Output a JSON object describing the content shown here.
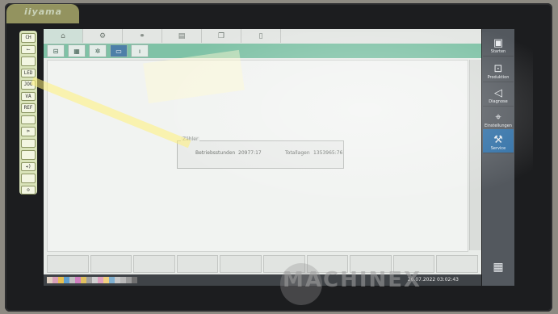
{
  "monitor": {
    "brand": "iiyama"
  },
  "keypad": {
    "keys": [
      "CH",
      "⟵",
      "",
      "LED",
      "JOG",
      "VA",
      "REF",
      "",
      "⊳",
      "",
      "",
      "◂)",
      "",
      "⊙"
    ]
  },
  "top_tabs": [
    "",
    "",
    "",
    "",
    "",
    ""
  ],
  "info_box": {
    "legend": "Zähler",
    "operating_hours_label": "Betriebsstunden",
    "operating_hours_value": "20977:17",
    "total_label": "Totallagen",
    "total_value": "1353965:76"
  },
  "right_panel": {
    "items": [
      {
        "label": "Starten",
        "icon": "home-icon"
      },
      {
        "label": "Produktion",
        "icon": "production-icon"
      },
      {
        "label": "Diagnose",
        "icon": "diagnosis-icon"
      },
      {
        "label": "Einstellungen",
        "icon": "settings-icon"
      },
      {
        "label": "Service",
        "icon": "wrench-icon",
        "active": true
      }
    ]
  },
  "status": {
    "datetime": "26.07.2022  03:02:43"
  },
  "watermark": {
    "text": "MACHINEX"
  },
  "colors": {
    "accent_green": "#7fc2a6",
    "active_blue": "#2f6fa6",
    "panel_dark": "#53585e"
  }
}
